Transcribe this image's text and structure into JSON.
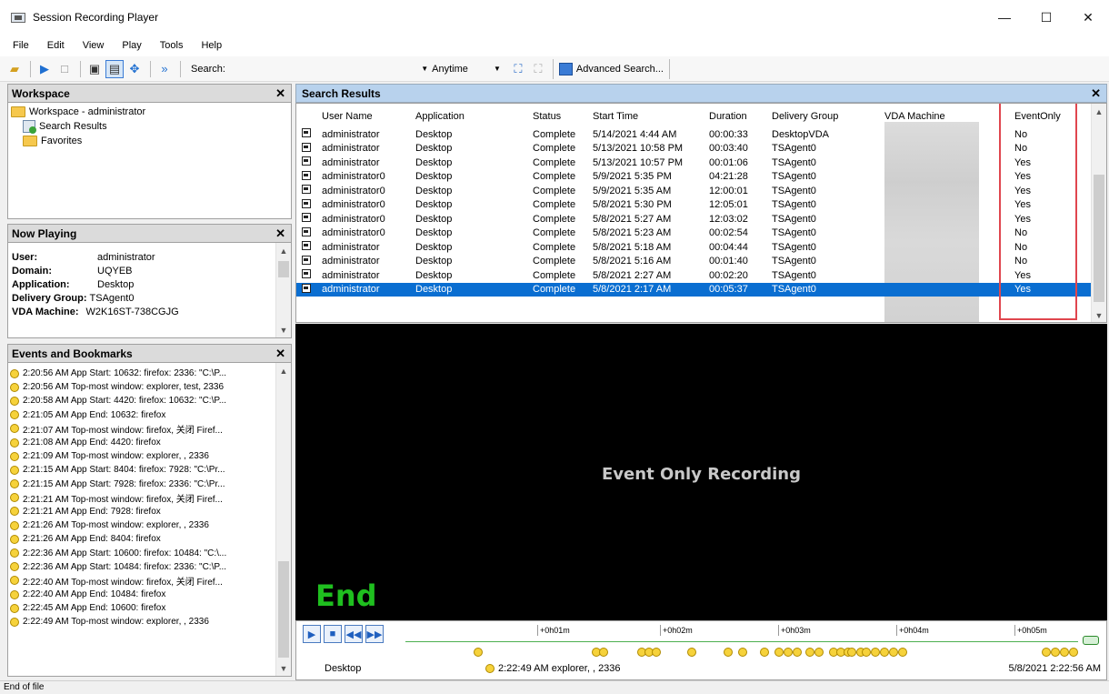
{
  "window": {
    "title": "Session Recording Player",
    "min": "—",
    "max": "☐",
    "close": "✕"
  },
  "menu": [
    "File",
    "Edit",
    "View",
    "Play",
    "Tools",
    "Help"
  ],
  "toolbar": {
    "search_label": "Search:",
    "time_filter": "Anytime",
    "advanced_search": "Advanced Search..."
  },
  "workspace": {
    "title": "Workspace",
    "tree": {
      "root": "Workspace - administrator",
      "search_results": "Search Results",
      "favorites": "Favorites"
    }
  },
  "now_playing": {
    "title": "Now Playing",
    "fields": [
      {
        "key": "User:",
        "value": "administrator"
      },
      {
        "key": "Domain:",
        "value": "UQYEB"
      },
      {
        "key": "Application:",
        "value": "Desktop"
      },
      {
        "key": "Delivery Group:",
        "value": "TSAgent0"
      },
      {
        "key": "VDA Machine:",
        "value": "W2K16ST-738CGJG"
      }
    ]
  },
  "events": {
    "title": "Events and Bookmarks",
    "items": [
      "2:20:56 AM  App Start: 10632: firefox: 2336: \"C:\\P...",
      "2:20:56 AM  Top-most window: explorer, test, 2336",
      "2:20:58 AM  App Start: 4420: firefox: 10632: \"C:\\P...",
      "2:21:05 AM App End: 10632: firefox",
      "2:21:07 AM   Top-most window: firefox, 关闭 Firef...",
      "2:21:08 AM App End: 4420: firefox",
      "2:21:09 AM Top-most window: explorer, , 2336",
      "2:21:15 AM  App Start: 8404: firefox: 7928: \"C:\\Pr...",
      "2:21:15 AM  App Start: 7928: firefox: 2336: \"C:\\Pr...",
      "2:21:21 AM   Top-most window: firefox, 关闭 Firef...",
      "2:21:21 AM App End: 7928: firefox",
      "2:21:26 AM  Top-most window: explorer, , 2336",
      "2:21:26 AM App End: 8404: firefox",
      "2:22:36 AM  App Start: 10600: firefox: 10484: \"C:\\...",
      "2:22:36 AM  App Start: 10484: firefox: 2336: \"C:\\P...",
      "2:22:40 AM   Top-most window: firefox, 关闭 Firef...",
      "2:22:40 AM App End: 10484: firefox",
      "2:22:45 AM App End: 10600: firefox",
      "2:22:49 AM Top-most window: explorer, , 2336"
    ]
  },
  "search_results": {
    "title": "Search Results",
    "columns": [
      "User Name",
      "Application",
      "Status",
      "Start Time",
      "Duration",
      "Delivery Group",
      "VDA Machine",
      "EventOnly"
    ],
    "rows": [
      [
        "administrator",
        "Desktop",
        "Complete",
        "5/14/2021 4:44 AM",
        "00:00:33",
        "DesktopVDA",
        "",
        "No"
      ],
      [
        "administrator",
        "Desktop",
        "Complete",
        "5/13/2021 10:58 PM",
        "00:03:40",
        "TSAgent0",
        "",
        "No"
      ],
      [
        "administrator",
        "Desktop",
        "Complete",
        "5/13/2021 10:57 PM",
        "00:01:06",
        "TSAgent0",
        "",
        "Yes"
      ],
      [
        "administrator0",
        "Desktop",
        "Complete",
        "5/9/2021 5:35 PM",
        "04:21:28",
        "TSAgent0",
        "",
        "Yes"
      ],
      [
        "administrator0",
        "Desktop",
        "Complete",
        "5/9/2021 5:35 AM",
        "12:00:01",
        "TSAgent0",
        "",
        "Yes"
      ],
      [
        "administrator0",
        "Desktop",
        "Complete",
        "5/8/2021 5:30 PM",
        "12:05:01",
        "TSAgent0",
        "",
        "Yes"
      ],
      [
        "administrator0",
        "Desktop",
        "Complete",
        "5/8/2021 5:27 AM",
        "12:03:02",
        "TSAgent0",
        "",
        "Yes"
      ],
      [
        "administrator0",
        "Desktop",
        "Complete",
        "5/8/2021 5:23 AM",
        "00:02:54",
        "TSAgent0",
        "",
        "No"
      ],
      [
        "administrator",
        "Desktop",
        "Complete",
        "5/8/2021 5:18 AM",
        "00:04:44",
        "TSAgent0",
        "",
        "No"
      ],
      [
        "administrator",
        "Desktop",
        "Complete",
        "5/8/2021 5:16 AM",
        "00:01:40",
        "TSAgent0",
        "",
        "No"
      ],
      [
        "administrator",
        "Desktop",
        "Complete",
        "5/8/2021 2:27 AM",
        "00:02:20",
        "TSAgent0",
        "",
        "Yes"
      ],
      [
        "administrator",
        "Desktop",
        "Complete",
        "5/8/2021 2:17 AM",
        "00:05:37",
        "TSAgent0",
        "",
        "Yes"
      ]
    ],
    "selected_row": 11
  },
  "player": {
    "caption": "Event Only Recording",
    "end_label": "End",
    "ticks": [
      "+0h01m",
      "+0h02m",
      "+0h03m",
      "+0h04m",
      "+0h05m"
    ],
    "application": "Desktop",
    "current_event": "2:22:49 AM  explorer, , 2336",
    "current_time": "5/8/2021 2:22:56 AM"
  },
  "status": "End of file",
  "colors": {
    "selection": "#0a6ed1",
    "highlight": "#e0464e",
    "end_label": "#1fbf1f",
    "search_header": "#b8d2ed"
  }
}
